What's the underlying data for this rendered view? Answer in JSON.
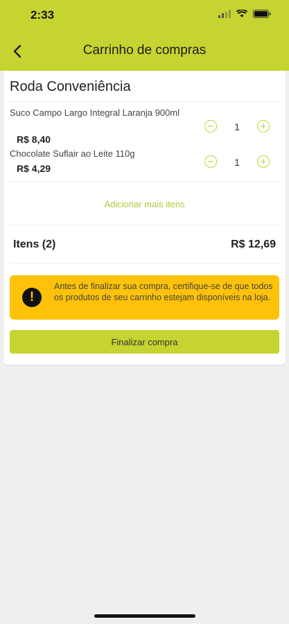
{
  "status_bar": {
    "time": "2:33"
  },
  "nav": {
    "title": "Carrinho de compras"
  },
  "store": {
    "name": "Roda Conveniência"
  },
  "items": [
    {
      "name": "Suco Campo Largo Integral Laranja 900ml",
      "price": "R$ 8,40",
      "quantity": "1"
    },
    {
      "name": "Chocolate Suflair ao Leite 110g",
      "price": "R$ 4,29",
      "quantity": "1"
    }
  ],
  "add_more_label": "Adicionar mais itens",
  "summary": {
    "items_label": "Itens (2)",
    "total": "R$ 12,69"
  },
  "warning": {
    "text": "Antes de finalizar sua compra, certifique-se de que todos os produtos de seu carrinho estejam disponíveis na loja."
  },
  "finish_label": "Finalizar compra",
  "colors": {
    "accent": "#c6d431",
    "warning": "#ffc20a",
    "background": "#efefef"
  }
}
